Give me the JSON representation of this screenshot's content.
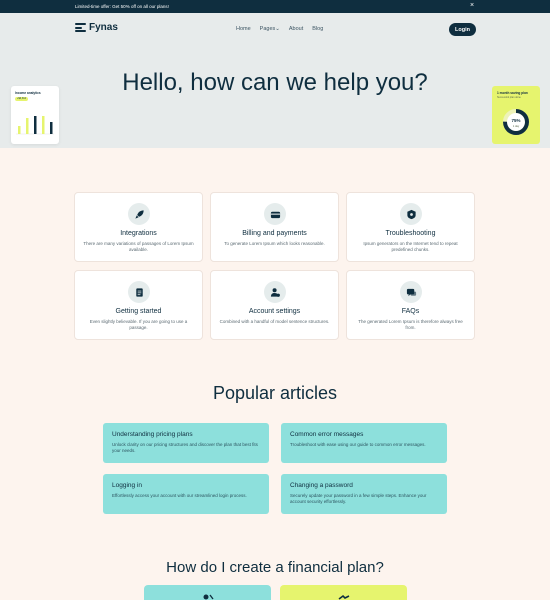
{
  "announcement": {
    "text": "Limited-time offer: Get 50% off on all our plans!",
    "close": "×"
  },
  "nav": {
    "logo": "Fynas",
    "links": [
      "Home",
      "Pages",
      "About",
      "Blog"
    ],
    "pages_chevron": "⌄",
    "login": "Login"
  },
  "hero": {
    "title": "Hello, how can we help you?",
    "widget_left": {
      "title": "Income analytics",
      "pill": "+$4,312"
    },
    "widget_right": {
      "title": "1 month saving plan",
      "sub": "Successful plan done",
      "percent": "75%",
      "percent_label": "1 day",
      "progress": 0.75
    }
  },
  "categories": [
    {
      "icon": "rocket-icon",
      "title": "Integrations",
      "desc": "There are many variations of passages of Lorem Ipsum available."
    },
    {
      "icon": "wallet-icon",
      "title": "Billing and payments",
      "desc": "To generate Lorem Ipsum which looks reasonable."
    },
    {
      "icon": "shield-icon",
      "title": "Troubleshooting",
      "desc": "Ipsum generators on the Internet tend to repeat predefined chunks."
    },
    {
      "icon": "clipboard-icon",
      "title": "Getting started",
      "desc": "Even slightly believable. If you are going to use a passage."
    },
    {
      "icon": "user-settings-icon",
      "title": "Account settings",
      "desc": "Combined with a handful of model sentence structures."
    },
    {
      "icon": "chat-icon",
      "title": "FAQs",
      "desc": "The generated Lorem Ipsum is therefore always free from."
    }
  ],
  "popular": {
    "title": "Popular articles",
    "articles": [
      {
        "title": "Understanding pricing plans",
        "desc": "Unlock clarity on our pricing structures and discover the plan that best fits your needs."
      },
      {
        "title": "Common error messages",
        "desc": "Troubleshoot with ease using our guide to common error messages."
      },
      {
        "title": "Logging in",
        "desc": "Effortlessly access your account with our streamlined login process."
      },
      {
        "title": "Changing a password",
        "desc": "Securely update your password in a few simple steps. Enhance your account security effortlessly."
      }
    ]
  },
  "financial": {
    "title": "How do I create a financial plan?"
  },
  "colors": {
    "navy": "#0f2e3f",
    "lime": "#e6f46e",
    "teal": "#8de0dc",
    "cream": "#fdf4ee"
  }
}
